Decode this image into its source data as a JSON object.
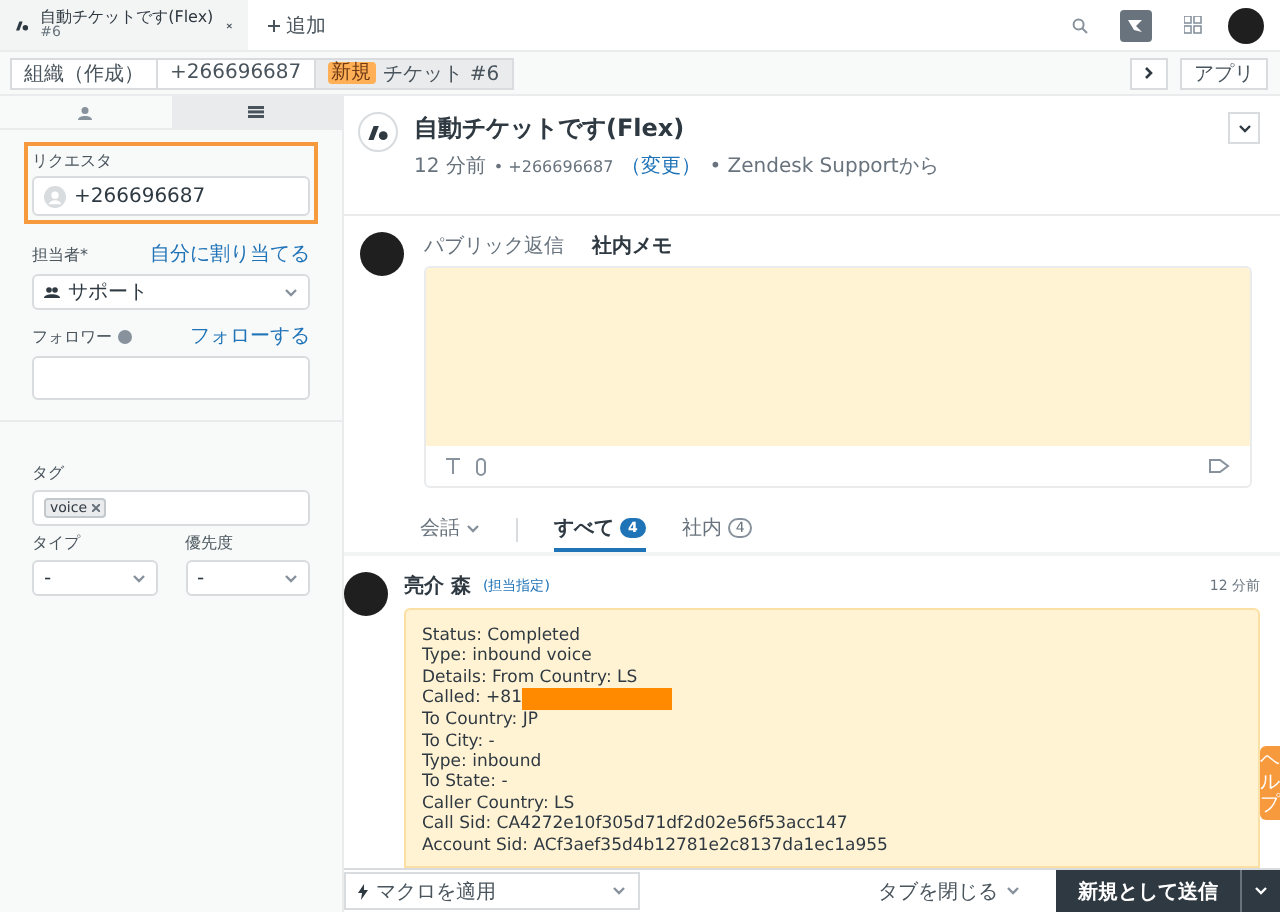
{
  "top_tabs": [
    {
      "title": "自動チケットです(Flex)",
      "subtitle": "#6",
      "selected": true
    }
  ],
  "add_tab": "追加",
  "breadcrumbs": [
    {
      "label": "組織（作成）"
    },
    {
      "label": "+266696687"
    },
    {
      "label": "チケット #6",
      "badge": "新規"
    }
  ],
  "apps_button": "アプリ",
  "sidebar": {
    "tabs": [
      {
        "kind": "user",
        "selected": false
      },
      {
        "kind": "menu",
        "selected": true
      }
    ],
    "requester": {
      "label": "リクエスタ",
      "value": "+266696687",
      "highlighted": true
    },
    "assignee": {
      "label": "担当者*",
      "action": "自分に割り当てる",
      "value": "サポート"
    },
    "followers": {
      "label": "フォロワー",
      "action": "フォローする"
    },
    "tags": {
      "label": "タグ",
      "items": [
        "voice"
      ]
    },
    "type": {
      "label": "タイプ",
      "value": "-"
    },
    "priority": {
      "label": "優先度",
      "value": "-"
    }
  },
  "ticket": {
    "title": "自動チケットです(Flex)",
    "time": "12 分前",
    "requester": "• +266696687",
    "change": "（変更）",
    "source": "• Zendesk Supportから"
  },
  "composer_tabs": [
    {
      "label": "パブリック返信",
      "selected": false
    },
    {
      "label": "社内メモ",
      "selected": true
    }
  ],
  "filters": {
    "conversation": "会話",
    "tabs": [
      {
        "label": "すべて",
        "count": "4",
        "selected": true
      },
      {
        "label": "社内",
        "count": "4",
        "selected": false
      }
    ]
  },
  "event": {
    "author": "亮介 森",
    "role": "(担当指定)",
    "time": "12 分前",
    "lines": [
      "Status: Completed",
      "Type: inbound voice",
      "Details: From Country: LS",
      "Called: +81",
      "To Country: JP",
      "To City: -",
      "Type: inbound",
      "To State: -",
      "Caller Country: LS",
      "Call Sid: CA4272e10f305d71df2d02e56f53acc147",
      "Account Sid: ACf3aef35d4b12781e2c8137da1ec1a955"
    ]
  },
  "help_tab": "ヘルプ",
  "footer": {
    "macro": "マクロを適用",
    "close_tab": "タブを閉じる",
    "submit": "新規として送信"
  }
}
